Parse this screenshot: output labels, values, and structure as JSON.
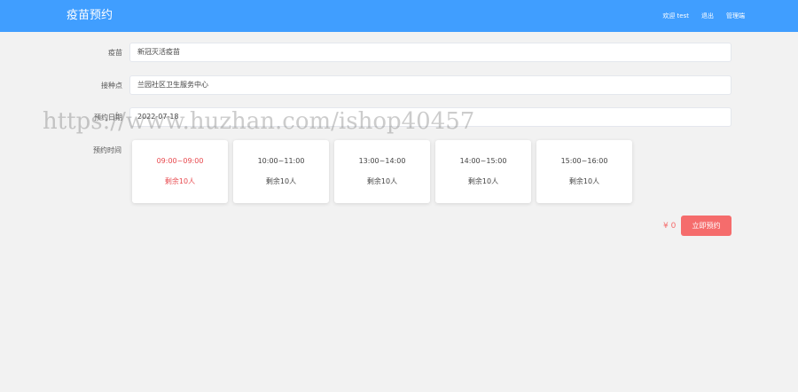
{
  "header": {
    "title": "疫苗预约",
    "welcome": "欢迎 test",
    "logout": "退出",
    "admin": "管理端"
  },
  "form": {
    "vaccine_label": "疫苗",
    "vaccine_value": "新冠灭活疫苗",
    "site_label": "接种点",
    "site_value": "兰园社区卫生服务中心",
    "date_label": "预约日期",
    "date_value": "2022-07-18",
    "time_label": "预约时间"
  },
  "slots": [
    {
      "time": "09:00~09:00",
      "remain": "剩余10人",
      "selected": true
    },
    {
      "time": "10:00~11:00",
      "remain": "剩余10人",
      "selected": false
    },
    {
      "time": "13:00~14:00",
      "remain": "剩余10人",
      "selected": false
    },
    {
      "time": "14:00~15:00",
      "remain": "剩余10人",
      "selected": false
    },
    {
      "time": "15:00~16:00",
      "remain": "剩余10人",
      "selected": false
    }
  ],
  "footer": {
    "price": "¥ 0",
    "book_button": "立即预约"
  },
  "watermark": "https://www.huzhan.com/ishop40457",
  "colors": {
    "primary": "#409eff",
    "accent": "#f56c6c",
    "selected_text": "#e8494e",
    "background": "#f2f2f2"
  }
}
